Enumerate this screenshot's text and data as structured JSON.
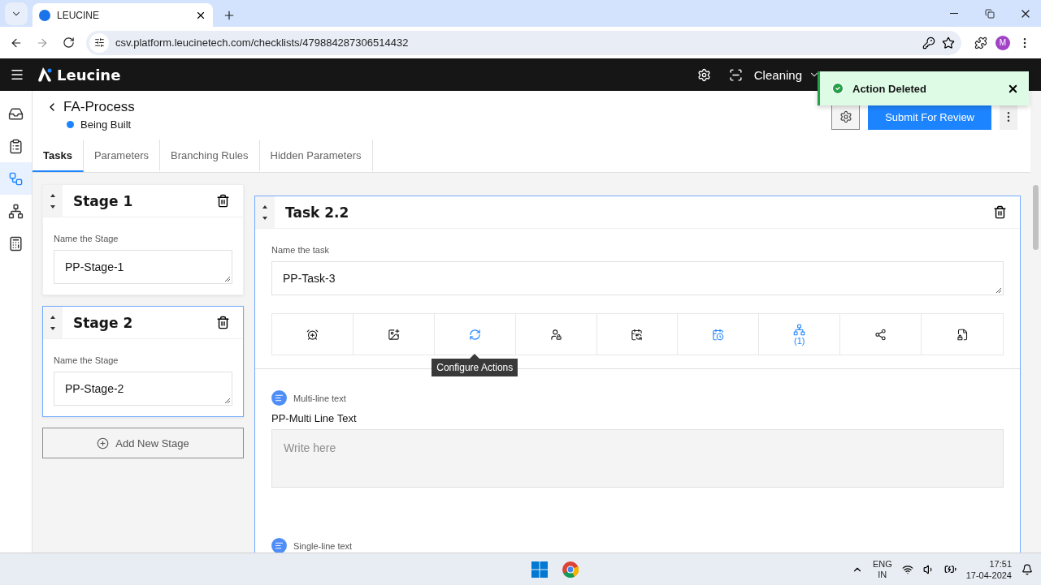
{
  "browser": {
    "tab_title": "LEUCINE",
    "url": "csv.platform.leucinetech.com/checklists/479884287306514432",
    "avatar": "M"
  },
  "header": {
    "brand": "Leucine",
    "facility": "Cleaning"
  },
  "toast": {
    "message": "Action Deleted"
  },
  "nav": [
    {
      "kind": "inbox",
      "selected": false
    },
    {
      "kind": "checklist",
      "selected": false
    },
    {
      "kind": "process",
      "selected": true
    },
    {
      "kind": "hierarchy",
      "selected": false
    },
    {
      "kind": "reports",
      "selected": false
    }
  ],
  "process": {
    "title": "FA-Process",
    "status": "Being Built",
    "submit": "Submit For Review"
  },
  "tabs": [
    {
      "label": "Tasks",
      "selected": true
    },
    {
      "label": "Parameters",
      "selected": false
    },
    {
      "label": "Branching Rules",
      "selected": false
    },
    {
      "label": "Hidden Parameters",
      "selected": false
    }
  ],
  "stages": [
    {
      "title": "Stage 1",
      "label": "Name the Stage",
      "value": "PP-Stage-1",
      "selected": false
    },
    {
      "title": "Stage 2",
      "label": "Name the Stage",
      "value": "PP-Stage-2",
      "selected": true
    }
  ],
  "add_stage": "Add New Stage",
  "task": {
    "title": "Task 2.2",
    "label": "Name the task",
    "value": "PP-Task-3",
    "actions": [
      {
        "kind": "timer",
        "active": false
      },
      {
        "kind": "media",
        "active": false
      },
      {
        "kind": "automation",
        "active": true,
        "tooltip": "Configure Actions"
      },
      {
        "kind": "assignee",
        "active": false
      },
      {
        "kind": "schedule",
        "active": false
      },
      {
        "kind": "recurrence",
        "active": true
      },
      {
        "kind": "branching",
        "active": true,
        "count": "(1)"
      },
      {
        "kind": "interlock",
        "active": false
      },
      {
        "kind": "lock",
        "active": false
      }
    ],
    "parameters": [
      {
        "type_label": "Multi-line text",
        "name": "PP-Multi Line Text",
        "placeholder": "Write here"
      },
      {
        "type_label": "Single-line text"
      }
    ]
  },
  "taskbar": {
    "lang": "ENG",
    "region": "IN",
    "time": "17:51",
    "date": "17-04-2024"
  }
}
